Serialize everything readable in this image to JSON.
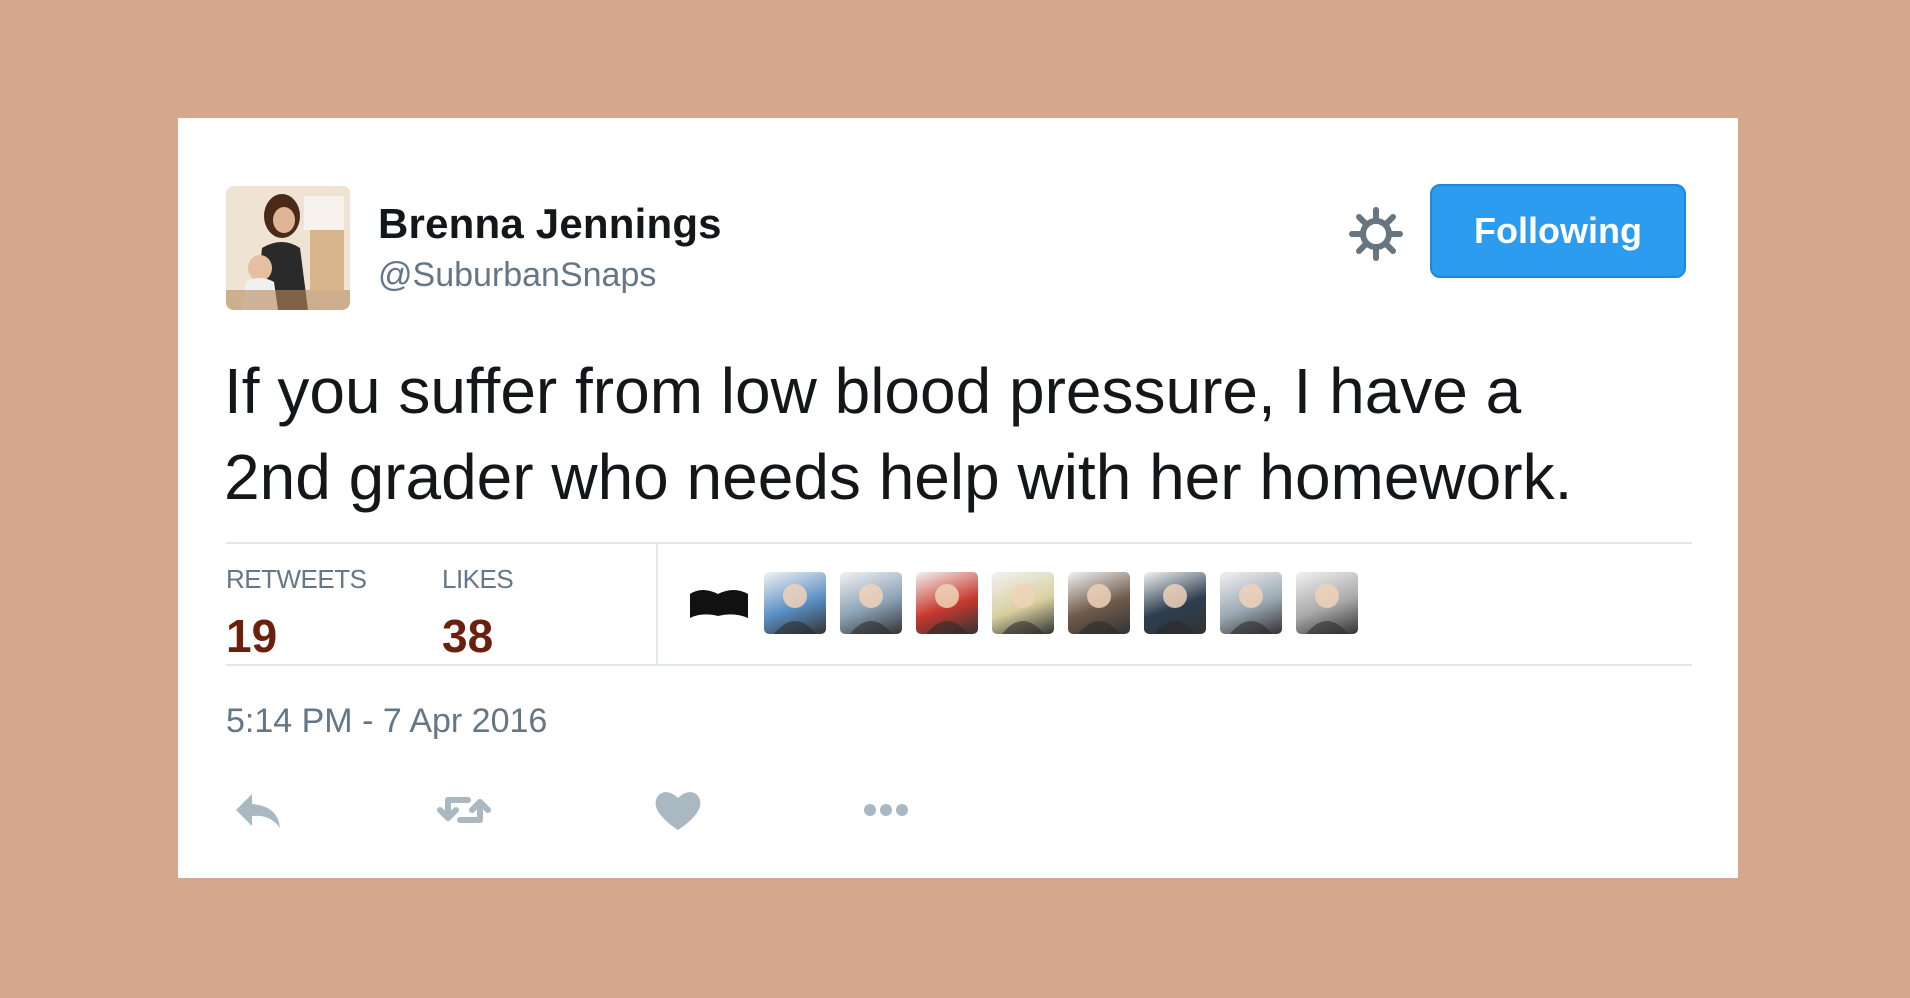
{
  "tweet": {
    "user": {
      "name": "Brenna Jennings",
      "handle": "@SuburbanSnaps",
      "avatar_icon": "profile-photo"
    },
    "follow_button": {
      "label": "Following",
      "color": "#2b9cf0"
    },
    "settings_icon": "gear-icon",
    "text_line1": "If you suffer from low blood pressure, I have a",
    "text_line2": "2nd grader who needs help with her homework.",
    "stats": {
      "retweets_label": "RETWEETS",
      "retweets_value": "19",
      "likes_label": "LIKES",
      "likes_value": "38"
    },
    "likers": [
      {
        "icon": "liker-avatar-1",
        "color": "#111111"
      },
      {
        "icon": "liker-avatar-2",
        "color": "#5a8fc4"
      },
      {
        "icon": "liker-avatar-3",
        "color": "#8aa1b5"
      },
      {
        "icon": "liker-avatar-4",
        "color": "#c8392e"
      },
      {
        "icon": "liker-avatar-5",
        "color": "#d8cfa0"
      },
      {
        "icon": "liker-avatar-6",
        "color": "#6f5a4a"
      },
      {
        "icon": "liker-avatar-7",
        "color": "#2c3e50"
      },
      {
        "icon": "liker-avatar-8",
        "color": "#9aa7b3"
      },
      {
        "icon": "liker-avatar-9",
        "color": "#a8a8a8"
      }
    ],
    "timestamp": "5:14 PM - 7 Apr 2016",
    "actions": {
      "reply_icon": "reply-icon",
      "retweet_icon": "retweet-icon",
      "like_icon": "heart-icon",
      "more_icon": "more-icon",
      "icon_color": "#aab8c2"
    },
    "background_color": "#d4a88c"
  }
}
